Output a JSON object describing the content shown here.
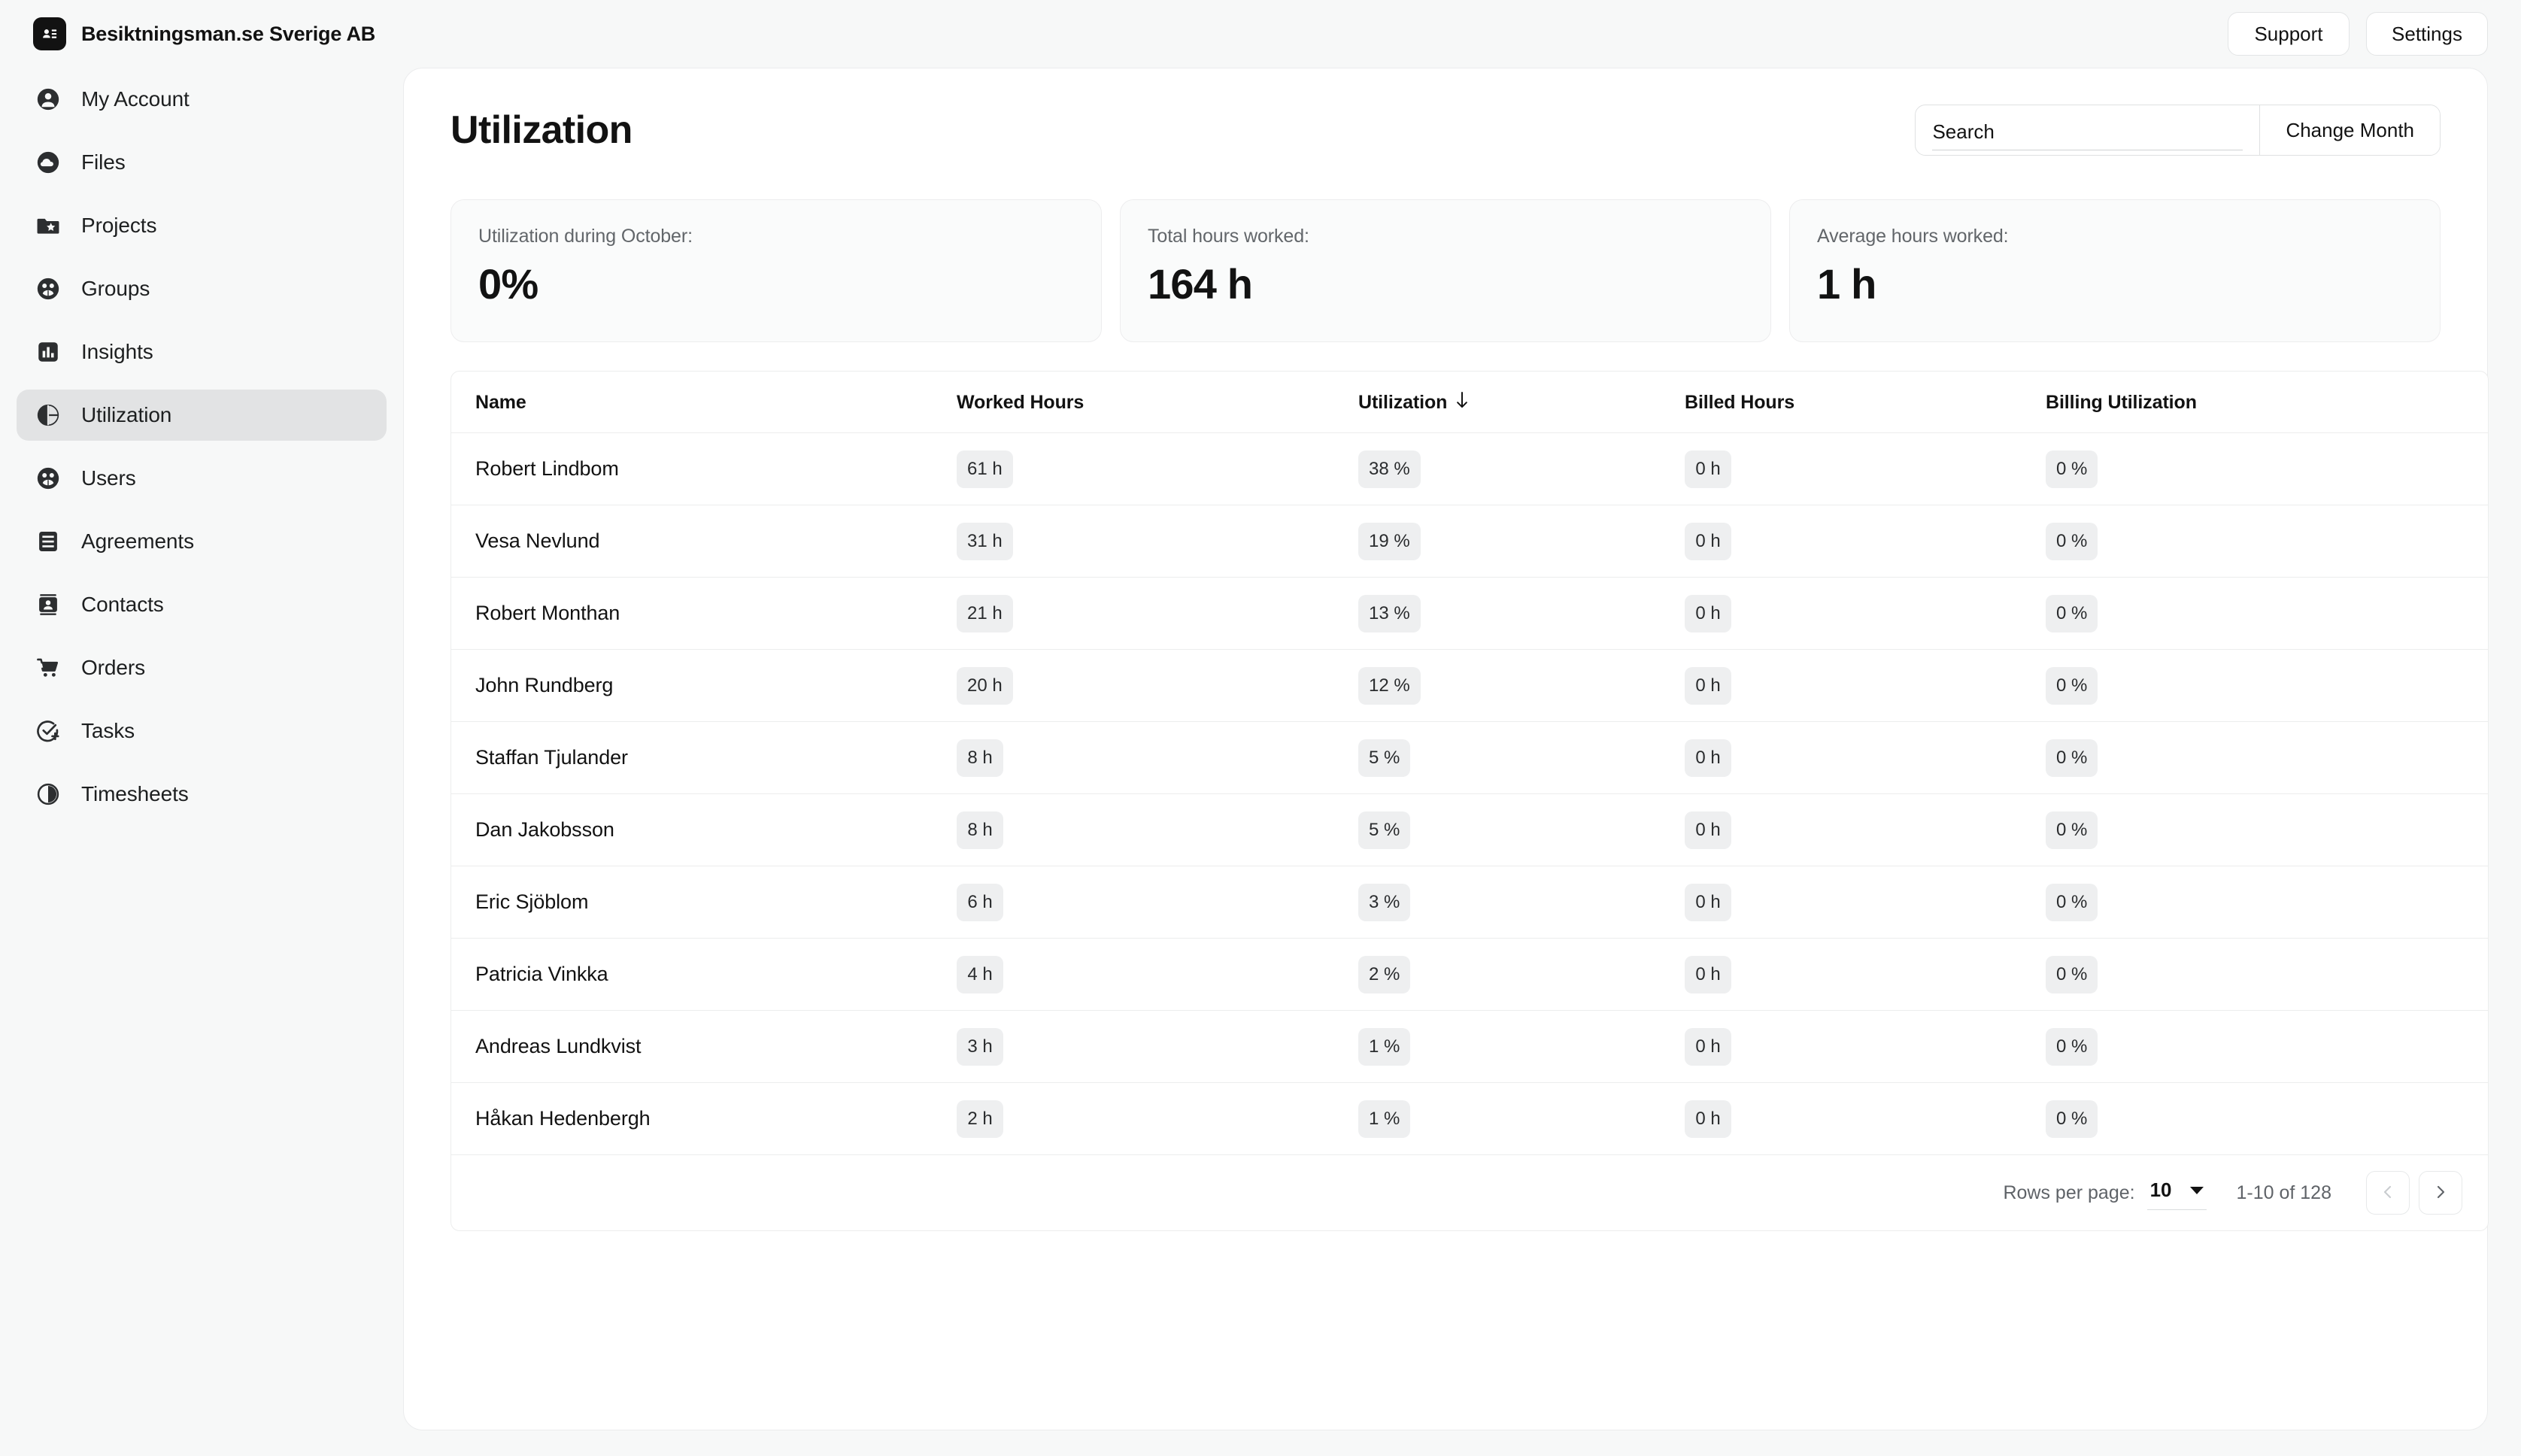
{
  "topbar": {
    "brand_name": "Besiktningsman.se Sverige AB",
    "brand_icon": "contact-card-icon",
    "support_label": "Support",
    "settings_label": "Settings"
  },
  "sidebar": {
    "items": [
      {
        "label": "My Account",
        "icon": "account-circle-icon",
        "active": false
      },
      {
        "label": "Files",
        "icon": "cloud-icon",
        "active": false
      },
      {
        "label": "Projects",
        "icon": "folder-star-icon",
        "active": false
      },
      {
        "label": "Groups",
        "icon": "group-icon",
        "active": false
      },
      {
        "label": "Insights",
        "icon": "bar-chart-icon",
        "active": false
      },
      {
        "label": "Utilization",
        "icon": "pie-chart-icon",
        "active": true
      },
      {
        "label": "Users",
        "icon": "group-icon",
        "active": false
      },
      {
        "label": "Agreements",
        "icon": "document-lines-icon",
        "active": false
      },
      {
        "label": "Contacts",
        "icon": "contact-card-icon",
        "active": false
      },
      {
        "label": "Orders",
        "icon": "shopping-cart-icon",
        "active": false
      },
      {
        "label": "Tasks",
        "icon": "check-circle-plus-icon",
        "active": false
      },
      {
        "label": "Timesheets",
        "icon": "clock-timer-icon",
        "active": false
      }
    ]
  },
  "page": {
    "title": "Utilization"
  },
  "search": {
    "value": "",
    "placeholder": "Search"
  },
  "actions": {
    "change_month_label": "Change Month"
  },
  "stats": [
    {
      "label": "Utilization during October:",
      "value": "0%"
    },
    {
      "label": "Total hours worked:",
      "value": "164 h"
    },
    {
      "label": "Average hours worked:",
      "value": "1 h"
    }
  ],
  "table": {
    "columns": [
      {
        "label": "Name",
        "sorted": false
      },
      {
        "label": "Worked Hours",
        "sorted": false
      },
      {
        "label": "Utilization",
        "sorted": true,
        "sort_icon": "arrow-down-icon"
      },
      {
        "label": "Billed Hours",
        "sorted": false
      },
      {
        "label": "Billing Utilization",
        "sorted": false
      }
    ],
    "rows": [
      {
        "name": "Robert Lindbom",
        "worked_hours": "61 h",
        "utilization": "38 %",
        "billed_hours": "0 h",
        "billing_utilization": "0 %"
      },
      {
        "name": "Vesa Nevlund",
        "worked_hours": "31 h",
        "utilization": "19 %",
        "billed_hours": "0 h",
        "billing_utilization": "0 %"
      },
      {
        "name": "Robert Monthan",
        "worked_hours": "21 h",
        "utilization": "13 %",
        "billed_hours": "0 h",
        "billing_utilization": "0 %"
      },
      {
        "name": "John Rundberg",
        "worked_hours": "20 h",
        "utilization": "12 %",
        "billed_hours": "0 h",
        "billing_utilization": "0 %"
      },
      {
        "name": "Staffan Tjulander",
        "worked_hours": "8 h",
        "utilization": "5 %",
        "billed_hours": "0 h",
        "billing_utilization": "0 %"
      },
      {
        "name": "Dan Jakobsson",
        "worked_hours": "8 h",
        "utilization": "5 %",
        "billed_hours": "0 h",
        "billing_utilization": "0 %"
      },
      {
        "name": "Eric Sjöblom",
        "worked_hours": "6 h",
        "utilization": "3 %",
        "billed_hours": "0 h",
        "billing_utilization": "0 %"
      },
      {
        "name": "Patricia Vinkka",
        "worked_hours": "4 h",
        "utilization": "2 %",
        "billed_hours": "0 h",
        "billing_utilization": "0 %"
      },
      {
        "name": "Andreas Lundkvist",
        "worked_hours": "3 h",
        "utilization": "1 %",
        "billed_hours": "0 h",
        "billing_utilization": "0 %"
      },
      {
        "name": "Håkan Hedenbergh",
        "worked_hours": "2 h",
        "utilization": "1 %",
        "billed_hours": "0 h",
        "billing_utilization": "0 %"
      }
    ]
  },
  "pagination": {
    "rows_per_page_label": "Rows per page:",
    "rows_per_page_value": "10",
    "range_label": "1-10 of 128",
    "prev_icon": "chevron-left-icon",
    "next_icon": "chevron-right-icon",
    "prev_disabled": true
  },
  "colors": {
    "page_bg": "#f7f8f8",
    "panel_bg": "#ffffff",
    "text": "#121212",
    "muted_text": "#62666a",
    "chip_bg": "#eeeff0",
    "active_nav_bg": "#e2e3e4",
    "border": "#eceded"
  }
}
